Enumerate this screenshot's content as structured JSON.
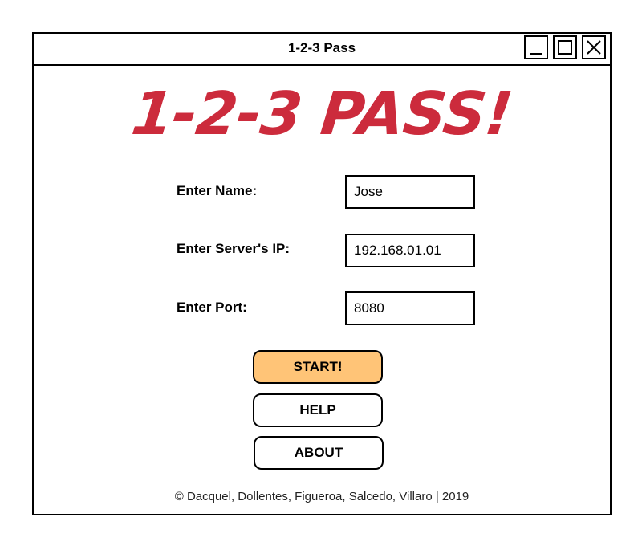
{
  "window": {
    "title": "1-2-3 Pass",
    "controls": {
      "minimize": "minimize-icon",
      "maximize": "maximize-icon",
      "close": "close-icon"
    }
  },
  "logo": {
    "text": "1-2-3 PASS!",
    "color": "#cc2b3c"
  },
  "form": {
    "name_label": "Enter Name:",
    "name_value": "Jose",
    "ip_label": "Enter Server's IP:",
    "ip_value": "192.168.01.01",
    "port_label": "Enter Port:",
    "port_value": "8080"
  },
  "buttons": {
    "start": "START!",
    "help": "HELP",
    "about": "ABOUT",
    "start_color": "#ffc477"
  },
  "footer": {
    "text": "© Dacquel, Dollentes, Figueroa, Salcedo, Villaro | 2019"
  }
}
